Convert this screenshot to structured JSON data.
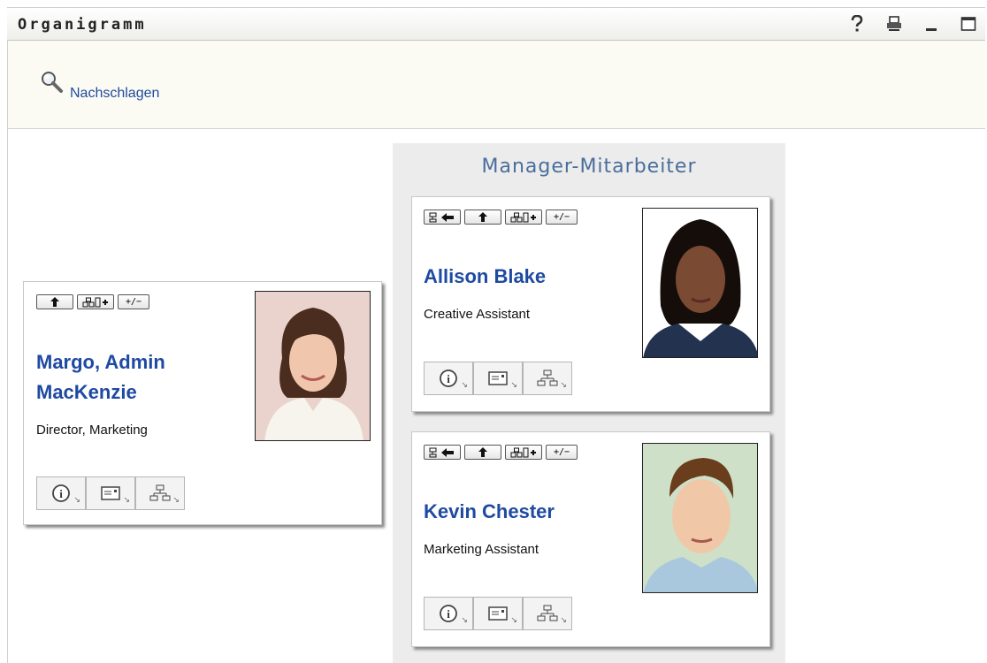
{
  "window": {
    "title": "Organigramm",
    "icons": [
      "help-icon",
      "print-icon",
      "minimize-icon",
      "maximize-icon"
    ]
  },
  "toolbar": {
    "lookup_label": "Nachschlagen"
  },
  "colors": {
    "link": "#1f4aa1",
    "panel_title": "#4a6e9b",
    "panel_bg": "#ececec"
  },
  "manager": {
    "name_line1": "Margo, Admin",
    "name_line2": "MacKenzie",
    "title": "Director, Marketing",
    "nav_buttons": [
      "up-arrow-icon",
      "expand-reports-icon",
      "toggle-plus-minus-icon"
    ],
    "toggle_label": "+/−"
  },
  "panel": {
    "title": "Manager-Mitarbeiter",
    "employees": [
      {
        "name": "Allison Blake",
        "title": "Creative Assistant"
      },
      {
        "name": "Kevin Chester",
        "title": "Marketing Assistant"
      }
    ]
  }
}
